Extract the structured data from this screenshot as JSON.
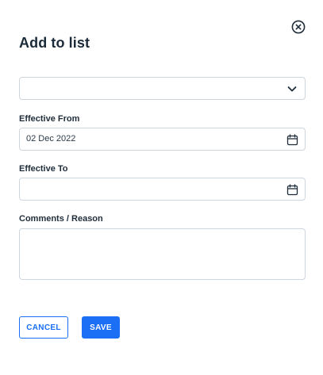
{
  "dialog": {
    "title": "Add to list",
    "close_icon": "close-circle-icon"
  },
  "list_select": {
    "value": "",
    "icon": "chevron-down-icon"
  },
  "effective_from": {
    "label": "Effective From",
    "value": "02 Dec 2022",
    "icon": "calendar-icon"
  },
  "effective_to": {
    "label": "Effective To",
    "value": "",
    "icon": "calendar-icon"
  },
  "comments": {
    "label": "Comments / Reason",
    "value": ""
  },
  "actions": {
    "cancel_label": "CANCEL",
    "save_label": "SAVE"
  },
  "colors": {
    "accent": "#1a6ff5",
    "text": "#1f2d3a",
    "border": "#cfd6dd"
  }
}
